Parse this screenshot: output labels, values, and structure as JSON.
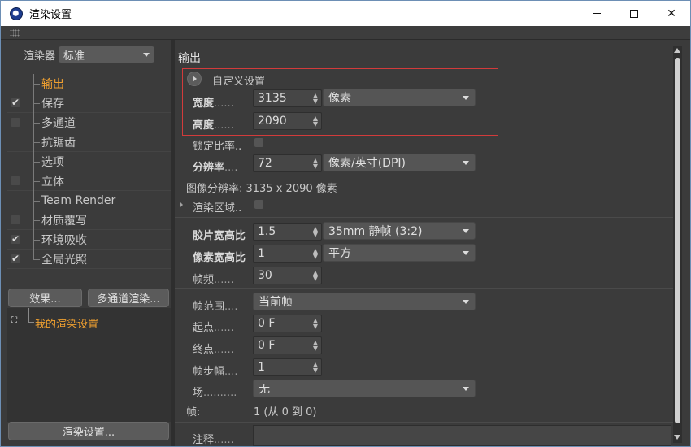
{
  "window": {
    "title": "渲染设置"
  },
  "left": {
    "renderer_label": "渲染器",
    "renderer_value": "标准",
    "tree": [
      {
        "label": "输出",
        "checkbox": false,
        "checked": false,
        "active": true
      },
      {
        "label": "保存",
        "checkbox": true,
        "checked": true,
        "active": false
      },
      {
        "label": "多通道",
        "checkbox": true,
        "checked": false,
        "active": false
      },
      {
        "label": "抗锯齿",
        "checkbox": false,
        "checked": false,
        "active": false
      },
      {
        "label": "选项",
        "checkbox": false,
        "checked": false,
        "active": false
      },
      {
        "label": "立体",
        "checkbox": true,
        "checked": false,
        "active": false
      },
      {
        "label": "Team Render",
        "checkbox": false,
        "checked": false,
        "active": false
      },
      {
        "label": "材质覆写",
        "checkbox": true,
        "checked": false,
        "active": false
      },
      {
        "label": "环境吸收",
        "checkbox": true,
        "checked": true,
        "active": false
      },
      {
        "label": "全局光照",
        "checkbox": true,
        "checked": true,
        "active": false
      }
    ],
    "effects_button": "效果...",
    "multipass_button": "多通道渲染...",
    "preset_label": "我的渲染设置",
    "render_settings_button": "渲染设置..."
  },
  "right": {
    "section_title": "输出",
    "custom_settings": "自定义设置",
    "width_label": "宽度",
    "width_dots": "......",
    "width_value": "3135",
    "height_label": "高度",
    "height_dots": "......",
    "height_value": "2090",
    "unit_value": "像素",
    "lock_ratio": "锁定比率..",
    "resolution_label": "分辨率",
    "resolution_dots": "....",
    "resolution_value": "72",
    "resolution_unit": "像素/英寸(DPI)",
    "image_resolution": "图像分辨率: 3135 x 2090 像素",
    "render_region": "渲染区域..",
    "film_aspect_label": "胶片宽高比",
    "film_aspect_value": "1.5",
    "film_aspect_preset": "35mm 静帧 (3:2)",
    "pixel_aspect_label": "像素宽高比",
    "pixel_aspect_value": "1",
    "pixel_aspect_preset": "平方",
    "fps_label": "帧频",
    "fps_dots": "......",
    "fps_value": "30",
    "frame_range_label": "帧范围",
    "frame_range_dots": "....",
    "frame_range_value": "当前帧",
    "start_label": "起点",
    "start_dots": "......",
    "start_value": "0 F",
    "end_label": "终点",
    "end_dots": "......",
    "end_value": "0 F",
    "step_label": "帧步幅",
    "step_dots": "....",
    "step_value": "1",
    "field_label": "场",
    "field_dots": "..........",
    "field_value": "无",
    "frames_label": "帧:",
    "frames_value": "1 (从 0 到 0)",
    "notes_label": "注释",
    "notes_dots": "......"
  },
  "colors": {
    "accent": "#f0a030",
    "highlight_border": "#d23b3b",
    "panel": "#3b3b3b"
  }
}
